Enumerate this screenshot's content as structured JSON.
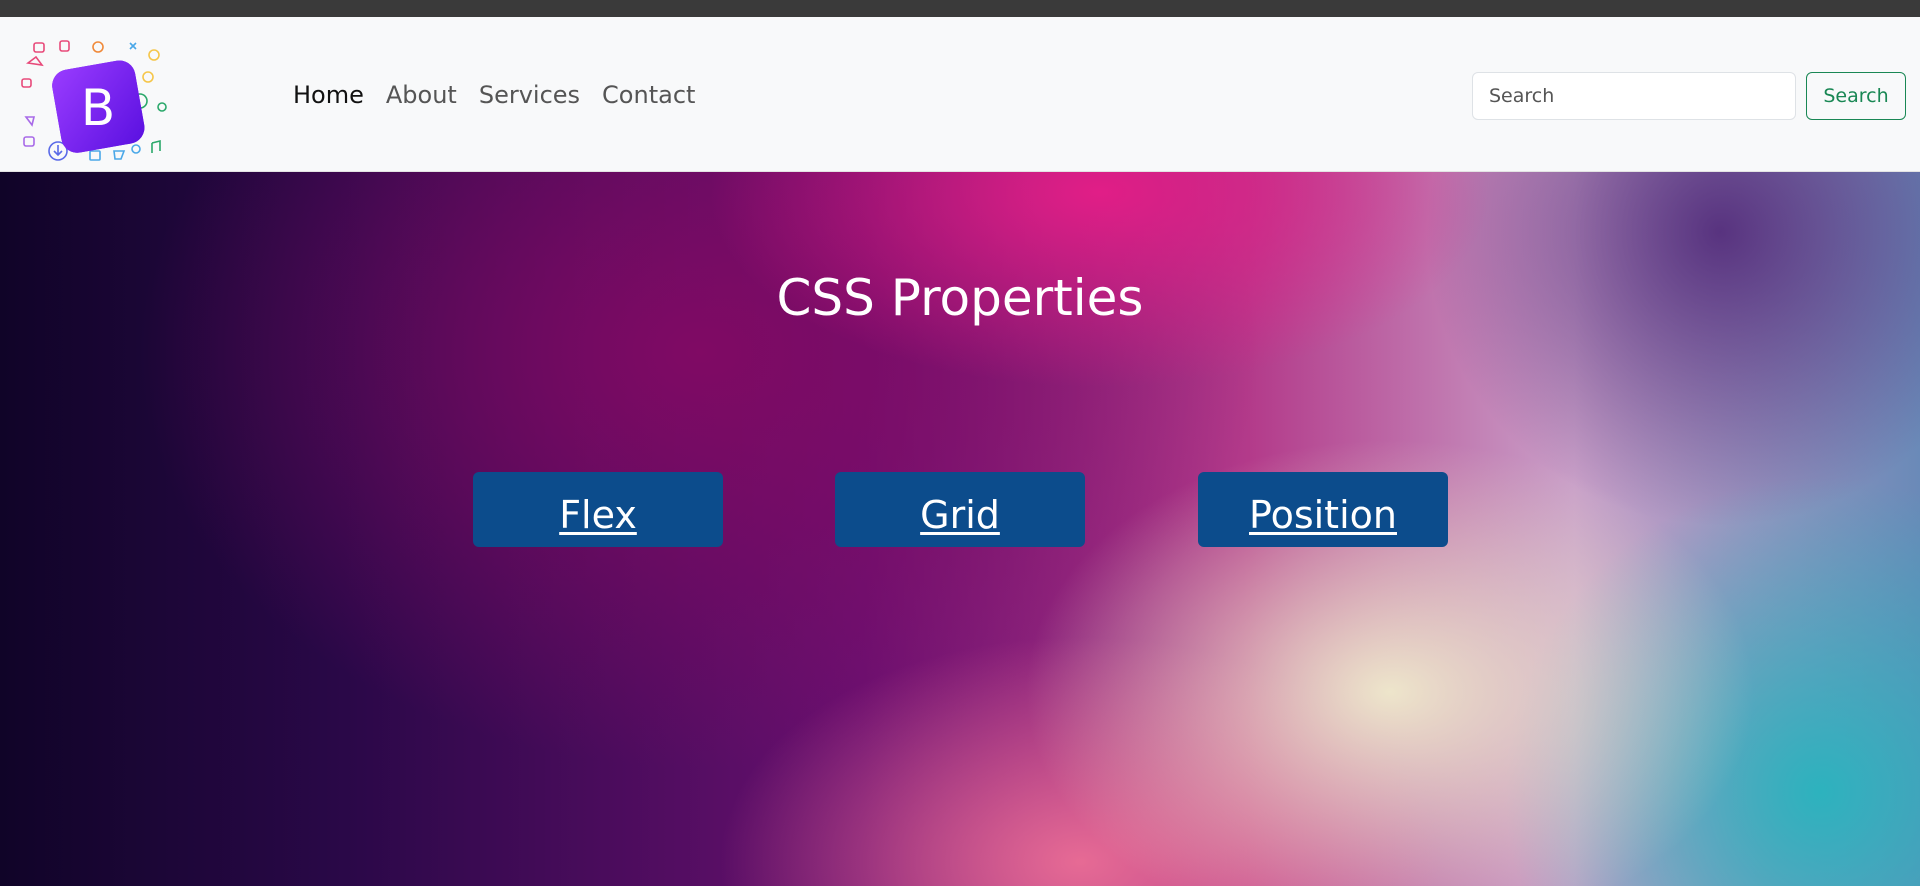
{
  "navbar": {
    "logo_letter": "B",
    "links": [
      {
        "label": "Home",
        "active": true
      },
      {
        "label": "About",
        "active": false
      },
      {
        "label": "Services",
        "active": false
      },
      {
        "label": "Contact",
        "active": false
      }
    ],
    "search": {
      "placeholder": "Search",
      "value": "",
      "button_label": "Search"
    }
  },
  "hero": {
    "title": "CSS Properties",
    "buttons": [
      {
        "label": "Flex"
      },
      {
        "label": "Grid"
      },
      {
        "label": "Position"
      }
    ]
  },
  "colors": {
    "navbar_bg": "#f8f9fa",
    "accent_green": "#198754",
    "button_blue": "#0c4c8c",
    "logo_purple": "#7b2ff7"
  },
  "icons": [
    "bootstrap-logo-icon"
  ]
}
